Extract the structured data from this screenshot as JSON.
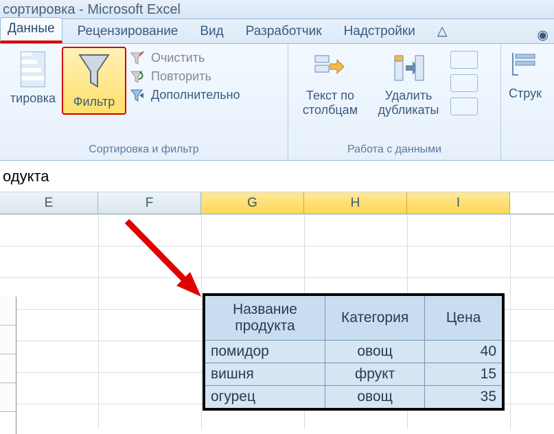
{
  "title": "сортировка - Microsoft Excel",
  "tabs": {
    "data": "Данные",
    "review": "Рецензирование",
    "view": "Вид",
    "developer": "Разработчик",
    "addins": "Надстройки"
  },
  "ribbon": {
    "sort_label": "тировка",
    "filter_label": "Фильтр",
    "clear": "Очистить",
    "reapply": "Повторить",
    "advanced": "Дополнительно",
    "group1_caption": "Сортировка и фильтр",
    "text_to_cols_l1": "Текст по",
    "text_to_cols_l2": "столбцам",
    "remove_dup_l1": "Удалить",
    "remove_dup_l2": "дубликаты",
    "group2_caption": "Работа с данными",
    "structure": "Струк"
  },
  "formula_text": "одукта",
  "columns": {
    "E": "E",
    "F": "F",
    "G": "G",
    "H": "H",
    "I": "I"
  },
  "table": {
    "h1": "Название продукта",
    "h2": "Категория",
    "h3": "Цена",
    "rows": [
      {
        "name": "помидор",
        "cat": "овощ",
        "price": "40"
      },
      {
        "name": "вишня",
        "cat": "фрукт",
        "price": "15"
      },
      {
        "name": "огурец",
        "cat": "овощ",
        "price": "35"
      }
    ]
  }
}
